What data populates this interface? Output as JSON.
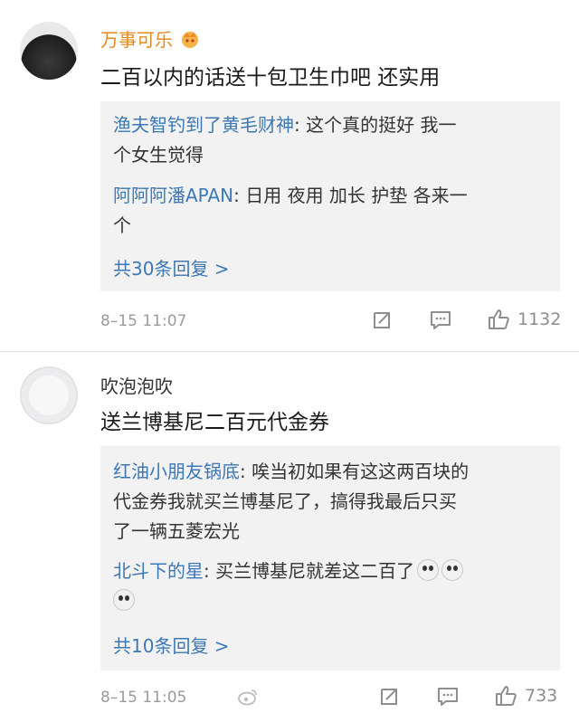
{
  "comments": [
    {
      "username": "万事可乐",
      "text": "二百以内的话送十包卫生巾吧 还实用",
      "replies": [
        {
          "name": "渔夫智钓到了黄毛财神",
          "sep": ":",
          "line1": " 这个真的挺好 我一",
          "line2": "个女生觉得"
        },
        {
          "name": "阿阿阿潘APAN",
          "sep": ":",
          "line1": " 日用 夜用 加长 护垫 各来一",
          "line2": "个"
        }
      ],
      "more_replies": "共30条回复 >",
      "time": "8–15 11:07",
      "likes": "1132"
    },
    {
      "username": "吹泡泡吹",
      "text": "送兰博基尼二百元代金券",
      "replies": [
        {
          "name": "红油小朋友锅底",
          "sep": ":",
          "line1": " 唉当初如果有这这两百块的",
          "line2": "代金券我就买兰博基尼了，搞得我最后只买",
          "line3": "了一辆五菱宏光"
        },
        {
          "name": "北斗下的星",
          "sep": ":",
          "line1": " 买兰博基尼就差这二百了"
        }
      ],
      "more_replies": "共10条回复 >",
      "time": "8–15 11:05",
      "likes": "733"
    }
  ],
  "icons": {
    "vip": "vip-crown-icon",
    "share": "share-icon",
    "comment": "comment-icon",
    "like": "like-thumb-icon",
    "emoji": "crying-face-emoji"
  },
  "colors": {
    "username_vip": "#e68a1e",
    "reply_name": "#3c78b5",
    "reply_box_bg": "#f2f2f3",
    "meta": "#9b9b9b"
  }
}
